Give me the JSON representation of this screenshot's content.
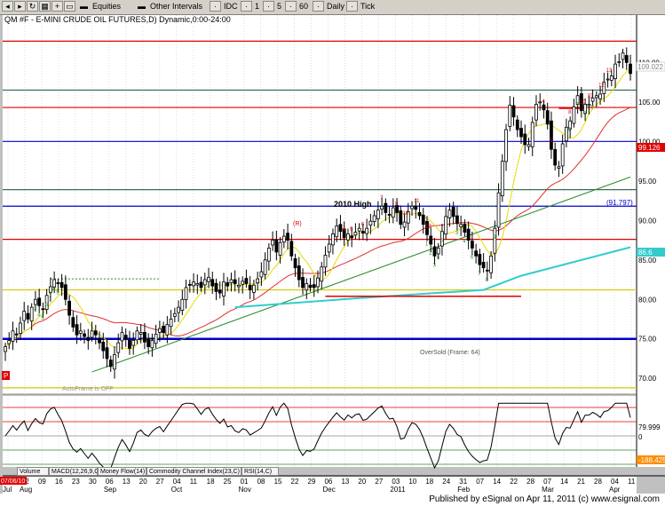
{
  "toolbar": {
    "items": [
      "Equities",
      "Other Intervals",
      "IDC",
      "1",
      "5",
      "60",
      "Daily",
      "Tick"
    ]
  },
  "chart_data": {
    "type": "candlestick",
    "title": "QM #F - E-MINI CRUDE OIL FUTURES,D) Dynamic,0:00-24:00",
    "ylim": [
      68,
      116
    ],
    "y_ticks": [
      110.0,
      105.0,
      100.0,
      95.0,
      90.0,
      85.0,
      80.0,
      75.0,
      70.0
    ],
    "y_tick_labels": [
      "110.00",
      "105.00",
      "100.00",
      "95.00",
      "90.00",
      "85.00",
      "80.00",
      "75.00",
      "70.00"
    ],
    "x_day_labels": [
      "19",
      "02",
      "09",
      "16",
      "23",
      "30",
      "06",
      "13",
      "20",
      "27",
      "04",
      "11",
      "18",
      "25",
      "01",
      "08",
      "15",
      "22",
      "29",
      "06",
      "13",
      "20",
      "27",
      "03",
      "10",
      "18",
      "24",
      "31",
      "07",
      "14",
      "22",
      "28",
      "07",
      "14",
      "21",
      "28",
      "04",
      "11"
    ],
    "x_month_labels": [
      "Jul",
      "Aug",
      "Sep",
      "Oct",
      "Nov",
      "Dec",
      "2011",
      "Feb",
      "Mar",
      "Apr"
    ],
    "start_date_label": "07/06/10",
    "last_price_label": "109.022",
    "price_labels": [
      "99.126",
      "(91.797)",
      "86.6"
    ],
    "horizontal_levels": [
      {
        "value": 112.7,
        "color": "#e00000"
      },
      {
        "value": 106.5,
        "color": "#3e6b5b"
      },
      {
        "value": 104.3,
        "color": "#e00000"
      },
      {
        "value": 100.0,
        "color": "#0000cc"
      },
      {
        "value": 93.9,
        "color": "#3e6b5b"
      },
      {
        "value": 91.8,
        "color": "#0000cc"
      },
      {
        "value": 87.6,
        "color": "#e00000"
      },
      {
        "value": 81.2,
        "color": "#d4c800"
      },
      {
        "value": 75.0,
        "color": "#0000cc"
      },
      {
        "value": 68.8,
        "color": "#d4c800"
      }
    ],
    "annotations": [
      "2010 High",
      "OverSold (Frame: 64)",
      "AutoFrame is OFF",
      "(R)",
      "P"
    ],
    "oscillator": {
      "labels": [
        "79.999",
        "0",
        "-188.425"
      ]
    },
    "indicator_tabs": [
      "Volume",
      "MACD(12,26,9,C)",
      "Money Flow(14)",
      "Commodity Channel Index(23,C)",
      "RSI(14,C)"
    ],
    "closes": [
      74,
      74.8,
      76,
      75.5,
      77,
      78.5,
      77.5,
      79,
      80,
      79.2,
      78.8,
      80.5,
      81.6,
      82.5,
      82,
      81.5,
      80,
      78,
      76.5,
      75.5,
      76,
      75.3,
      74.8,
      76,
      75.5,
      74.5,
      73.5,
      72.5,
      71.5,
      73,
      74.5,
      75.8,
      75,
      73.8,
      74.8,
      76,
      75.8,
      74.6,
      74,
      74.8,
      75.6,
      76.3,
      75.8,
      76.8,
      77.5,
      78.2,
      79,
      80,
      81.5,
      81.8,
      82.2,
      82,
      81.5,
      82.5,
      82.8,
      81.7,
      81,
      80.8,
      82.2,
      81.7,
      82.5,
      82,
      81.8,
      82.3,
      82,
      81.2,
      81.8,
      82.6,
      83.5,
      85,
      86.5,
      87.5,
      86,
      87.2,
      88,
      87.5,
      85.5,
      84,
      82.5,
      81.5,
      82,
      81.5,
      81.5,
      82.7,
      84.1,
      85.6,
      87,
      88.3,
      89.3,
      88.6,
      87.8,
      88.3,
      87.8,
      88.5,
      89,
      88.4,
      89,
      89.9,
      90.6,
      91.3,
      91.8,
      91,
      90.7,
      91.6,
      91,
      89.5,
      89.8,
      91.1,
      91.8,
      91.4,
      90.6,
      89.5,
      88.2,
      87,
      85.5,
      86.5,
      88.6,
      90.5,
      91.3,
      90.5,
      89.6,
      89.5,
      88.5,
      87.5,
      86.5,
      85.5,
      84.4,
      84,
      83.6,
      85.5,
      89,
      93.5,
      97.5,
      101.5,
      104.6,
      103.1,
      101.5,
      100.6,
      99.6,
      99.6,
      102.4,
      104.7,
      105,
      104,
      102.2,
      99,
      97,
      96.8,
      99.7,
      101.8,
      102.6,
      104.4,
      105.8,
      103.9,
      104.7,
      104.7,
      105.5,
      105.8,
      106,
      107.5,
      107.9,
      108.3,
      109.8,
      110.1,
      111.2,
      110,
      108.6
    ],
    "line_series": [
      {
        "name": "",
        "color": "#e03030"
      },
      {
        "name": "",
        "color": "#e6dc00"
      },
      {
        "name": "",
        "color": "#2a8a2a"
      },
      {
        "name": "",
        "color": "#33cccc"
      }
    ]
  },
  "status": {
    "text": "Published by eSignal on Apr 11, 2011 (c) www.esignal.com"
  }
}
